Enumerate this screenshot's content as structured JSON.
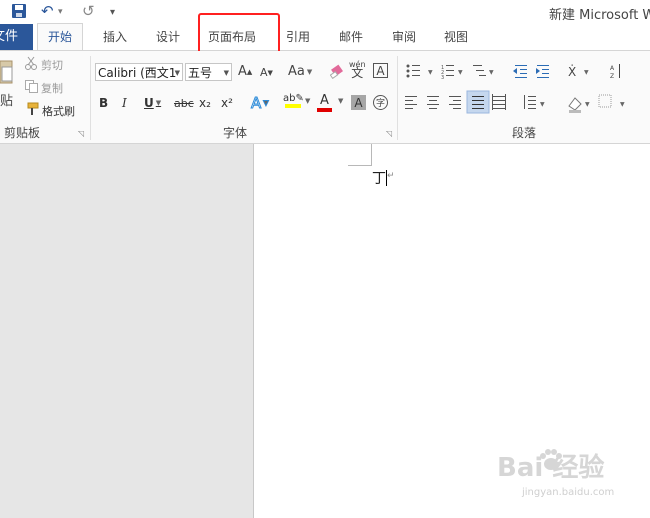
{
  "titlebar": {
    "title": "新建 Microsoft W",
    "undo": "↶",
    "redo": "↺",
    "customize": "▾"
  },
  "tabs": [
    {
      "label": "文件"
    },
    {
      "label": "开始"
    },
    {
      "label": "插入"
    },
    {
      "label": "设计"
    },
    {
      "label": "页面布局"
    },
    {
      "label": "引用"
    },
    {
      "label": "邮件"
    },
    {
      "label": "审阅"
    },
    {
      "label": "视图"
    }
  ],
  "clipboard": {
    "paste": "贴",
    "cut": "剪切",
    "copy": "复制",
    "format_painter": "格式刷",
    "group_label": "剪贴板"
  },
  "font": {
    "font_name": "Calibri (西文1",
    "font_size": "五号",
    "grow": "A",
    "shrink": "A",
    "case": "Aa",
    "bold": "B",
    "italic": "I",
    "underline": "U",
    "strike": "abc",
    "subscript": "x₂",
    "superscript": "x²",
    "phonetic_top": "wén",
    "phonetic_bottom": "文",
    "border_char": "A",
    "enclose_char": "字",
    "group_label": "字体"
  },
  "paragraph": {
    "group_label": "段落"
  },
  "document": {
    "text": "丁"
  },
  "watermark": {
    "brand": "Bai  经验",
    "url": "jingyan.baidu.com"
  },
  "colors": {
    "accent": "#2b579a",
    "highlight_box": "#ff2020",
    "font_color": "#e00000",
    "highlight_color": "#ffff00"
  }
}
